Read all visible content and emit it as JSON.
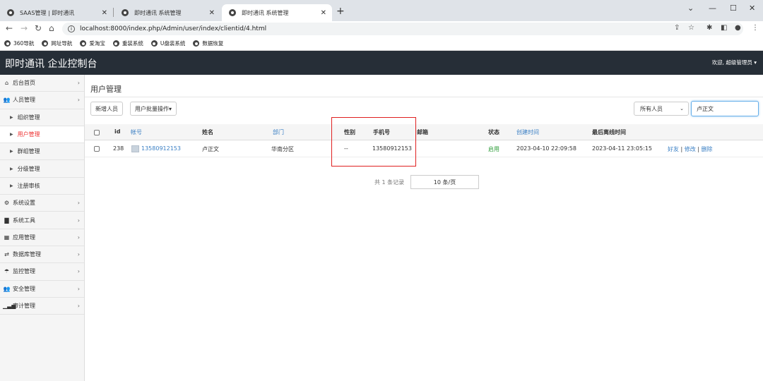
{
  "browser": {
    "tabs": [
      {
        "title": "SAAS管理 | 即时通讯",
        "active": false
      },
      {
        "title": "即时通讯 系统管理",
        "active": false
      },
      {
        "title": "即时通讯 系统管理",
        "active": true
      }
    ],
    "new_tab": "+",
    "url": "localhost:8000/index.php/Admin/user/index/clientid/4.html",
    "bookmarks": [
      "360导航",
      "网址导航",
      "爱淘宝",
      "重装系统",
      "U盘装系统",
      "数据恢复"
    ]
  },
  "header": {
    "brand": "即时通讯 企业控制台",
    "welcome": "欢迎, 超级管理员 ▾"
  },
  "sidebar": {
    "items": [
      {
        "label": "后台首页",
        "icon": "home-icon",
        "sub": false
      },
      {
        "label": "人员管理",
        "icon": "users-icon",
        "sub": false
      },
      {
        "label": "组织管理",
        "sub": true
      },
      {
        "label": "用户管理",
        "sub": true,
        "active": true
      },
      {
        "label": "群组管理",
        "sub": true
      },
      {
        "label": "分级管理",
        "sub": true
      },
      {
        "label": "注册审核",
        "sub": true
      },
      {
        "label": "系统设置",
        "icon": "gears-icon",
        "sub": false
      },
      {
        "label": "系统工具",
        "icon": "briefcase-icon",
        "sub": false
      },
      {
        "label": "应用管理",
        "icon": "grid-icon",
        "sub": false
      },
      {
        "label": "数据库管理",
        "icon": "exchange-icon",
        "sub": false
      },
      {
        "label": "监控管理",
        "icon": "umbrella-icon",
        "sub": false
      },
      {
        "label": "安全管理",
        "icon": "users-icon",
        "sub": false
      },
      {
        "label": "审计管理",
        "icon": "bar-chart-icon",
        "sub": false
      }
    ]
  },
  "main": {
    "title": "用户管理",
    "add_button": "新增人员",
    "batch_button": "用户批量操作▾",
    "filter_select": "所有人员",
    "search_value": "卢正文",
    "columns": {
      "id": "id",
      "account": "帐号",
      "name": "姓名",
      "dept": "部门",
      "gender": "性别",
      "phone": "手机号",
      "email": "邮箱",
      "status": "状态",
      "created": "创建时间",
      "last_offline": "最后离线时间"
    },
    "rows": [
      {
        "id": "238",
        "account": "13580912153",
        "name": "卢正文",
        "dept": "华南分区",
        "gender": "--",
        "phone": "13580912153",
        "email": "",
        "status": "启用",
        "created": "2023-04-10 22:09:58",
        "last_offline": "2023-04-11 23:05:15",
        "action_friend": "好友",
        "sep1": " | ",
        "action_edit": "修改",
        "sep2": " | ",
        "action_delete": "删除"
      }
    ],
    "record_count": "共 1 条记录",
    "page_size": "10 条/页"
  },
  "colors": {
    "header_bg": "#262e37",
    "link": "#3a7fc4",
    "active_menu": "#e33333",
    "status_green": "#2e9d3a",
    "annotation_red": "#e02020"
  }
}
